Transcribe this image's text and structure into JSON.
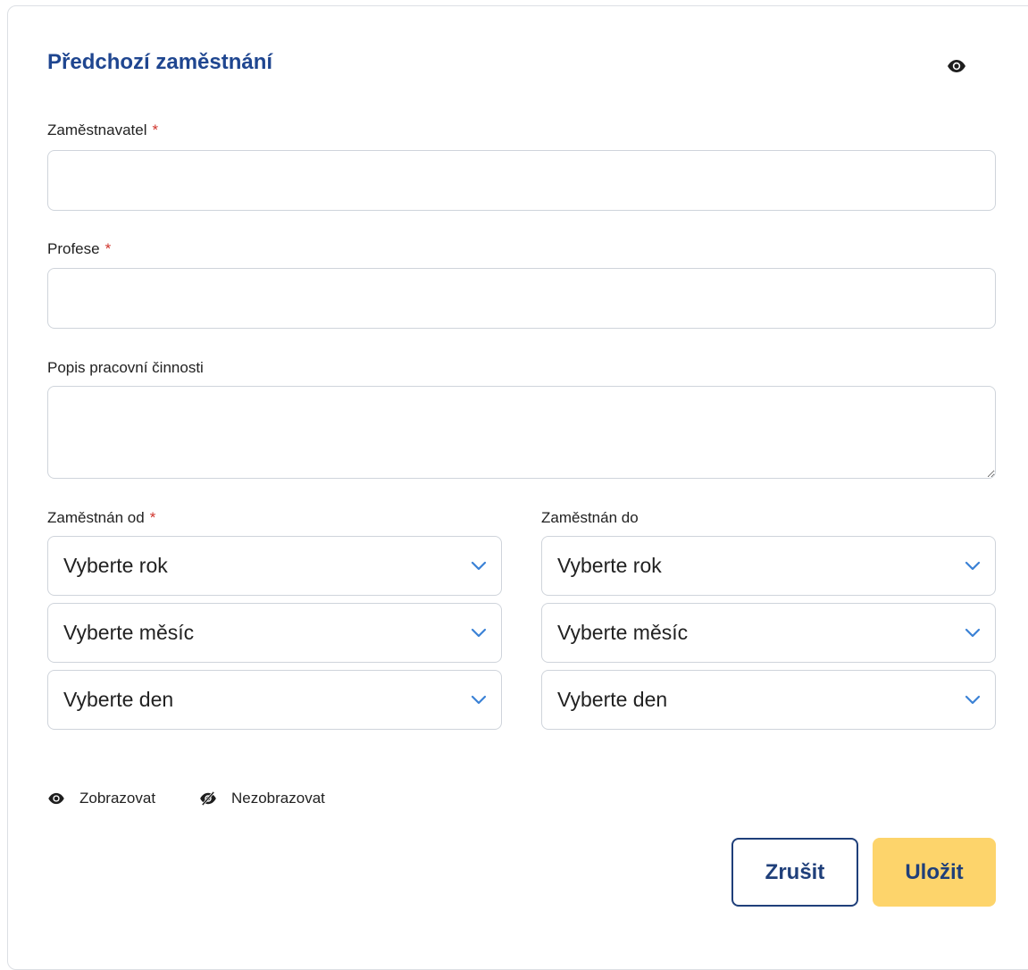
{
  "form": {
    "title": "Předchozí zaměstnání",
    "required_mark": "*",
    "employer": {
      "label": "Zaměstnavatel",
      "value": "",
      "placeholder": ""
    },
    "profession": {
      "label": "Profese",
      "value": "",
      "placeholder": ""
    },
    "description": {
      "label": "Popis pracovní činnosti",
      "value": "",
      "placeholder": ""
    },
    "employed_from": {
      "label": "Zaměstnán od",
      "year": "Vyberte rok",
      "month": "Vyberte měsíc",
      "day": "Vyberte den"
    },
    "employed_to": {
      "label": "Zaměstnán do",
      "year": "Vyberte rok",
      "month": "Vyberte měsíc",
      "day": "Vyberte den"
    }
  },
  "legend": {
    "show": {
      "label": "Zobrazovat",
      "icon": "eye-icon"
    },
    "hide": {
      "label": "Nezobrazovat",
      "icon": "eye-slash-icon"
    }
  },
  "actions": {
    "cancel_label": "Zrušit",
    "save_label": "Uložit"
  },
  "colors": {
    "title": "#1f4690",
    "required": "#d0342c",
    "chevron": "#3b82d6",
    "save_button": "#fdd46b",
    "button_text": "#1f3f7a"
  },
  "visibility_icon": "eye-icon"
}
